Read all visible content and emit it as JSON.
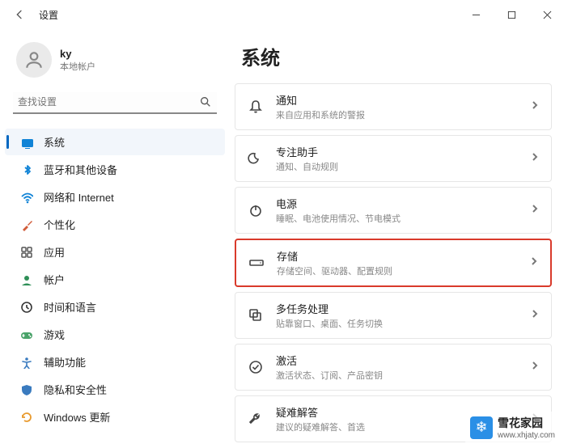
{
  "app": {
    "title": "设置"
  },
  "profile": {
    "name": "ky",
    "sub": "本地帐户"
  },
  "search": {
    "placeholder": "查找设置"
  },
  "nav": {
    "items": [
      {
        "id": "system",
        "label": "系统",
        "icon": "display",
        "color": "#1083d6",
        "active": true
      },
      {
        "id": "bluetooth",
        "label": "蓝牙和其他设备",
        "icon": "bluetooth",
        "color": "#1083d6"
      },
      {
        "id": "network",
        "label": "网络和 Internet",
        "icon": "wifi",
        "color": "#1083d6"
      },
      {
        "id": "personalize",
        "label": "个性化",
        "icon": "brush",
        "color": "#d15c3a"
      },
      {
        "id": "apps",
        "label": "应用",
        "icon": "grid",
        "color": "#555"
      },
      {
        "id": "accounts",
        "label": "帐户",
        "icon": "user",
        "color": "#2e8f57"
      },
      {
        "id": "time",
        "label": "时间和语言",
        "icon": "clock",
        "color": "#333"
      },
      {
        "id": "gaming",
        "label": "游戏",
        "icon": "game",
        "color": "#4aa36a"
      },
      {
        "id": "access",
        "label": "辅助功能",
        "icon": "access",
        "color": "#3a7bbf"
      },
      {
        "id": "privacy",
        "label": "隐私和安全性",
        "icon": "shield",
        "color": "#3a7bbf"
      },
      {
        "id": "update",
        "label": "Windows 更新",
        "icon": "update",
        "color": "#e89a2e"
      }
    ]
  },
  "page": {
    "title": "系统",
    "cards": [
      {
        "id": "notifications",
        "icon": "bell",
        "title": "通知",
        "sub": "来自应用和系统的警报"
      },
      {
        "id": "focus",
        "icon": "moon",
        "title": "专注助手",
        "sub": "通知、自动规则"
      },
      {
        "id": "power",
        "icon": "power",
        "title": "电源",
        "sub": "睡眠、电池使用情况、节电模式"
      },
      {
        "id": "storage",
        "icon": "drive",
        "title": "存储",
        "sub": "存储空间、驱动器、配置规则",
        "highlighted": true
      },
      {
        "id": "multitask",
        "icon": "windows",
        "title": "多任务处理",
        "sub": "贴靠窗口、桌面、任务切换"
      },
      {
        "id": "activation",
        "icon": "check",
        "title": "激活",
        "sub": "激活状态、订阅、产品密钥"
      },
      {
        "id": "troubleshoot",
        "icon": "wrench",
        "title": "疑难解答",
        "sub": "建议的疑难解答、首选"
      }
    ]
  },
  "watermark": {
    "brand": "雪花家园",
    "url": "www.xhjaty.com",
    "glyph": "❄"
  }
}
